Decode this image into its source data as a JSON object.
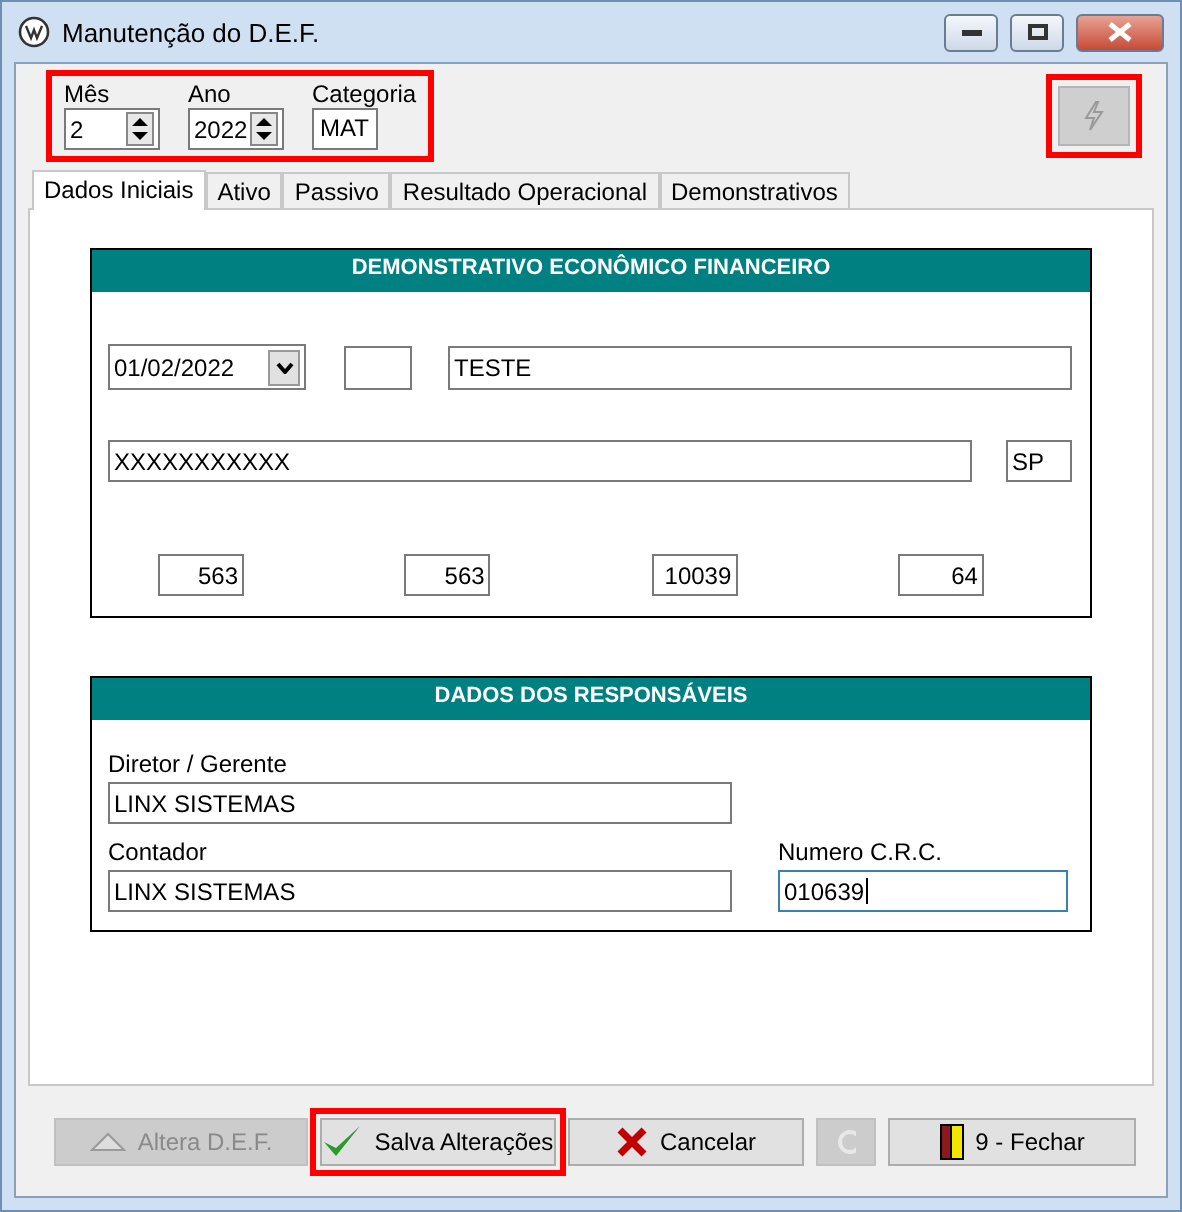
{
  "window": {
    "title": "Manutenção do D.E.F."
  },
  "period": {
    "highlighted": true,
    "fields": [
      {
        "label": "Mês",
        "value": "2",
        "kind": "spin"
      },
      {
        "label": "Ano",
        "value": "2022",
        "kind": "spin"
      },
      {
        "label": "Categoria",
        "value": "MAT",
        "kind": "text"
      }
    ]
  },
  "action_button": {
    "disabled": true,
    "highlighted": true
  },
  "tabs": [
    {
      "label": "Dados Iniciais",
      "selected": true
    },
    {
      "label": "Ativo",
      "selected": false
    },
    {
      "label": "Passivo",
      "selected": false
    },
    {
      "label": "Resultado Operacional",
      "selected": false
    },
    {
      "label": "Demonstrativos",
      "selected": false
    }
  ],
  "def_group": {
    "title": "DEMONSTRATIVO ECONÔMICO FINANCEIRO",
    "date": "01/02/2022",
    "name": "TESTE",
    "address": "XXXXXXXXXXX",
    "state": "SP",
    "numbers": [
      "563",
      "563",
      "10039",
      "64"
    ]
  },
  "responsaveis": {
    "title": "DADOS DOS RESPONSÁVEIS",
    "fields": [
      {
        "label": "Diretor / Gerente",
        "value": "LINX SISTEMAS",
        "focused": false
      },
      {
        "label": "Contador",
        "value": "LINX SISTEMAS",
        "focused": false
      },
      {
        "label": "Numero C.R.C.",
        "value": "010639",
        "focused": true
      }
    ]
  },
  "buttons": [
    {
      "kind": "edit",
      "label": "Altera D.E.F.",
      "disabled": true,
      "highlighted": false
    },
    {
      "kind": "save",
      "label": "Salva Alterações",
      "disabled": false,
      "highlighted": true
    },
    {
      "kind": "cancel",
      "label": "Cancelar",
      "disabled": false,
      "highlighted": false
    },
    {
      "kind": "hidden",
      "disabled": true,
      "highlighted": false
    },
    {
      "kind": "close",
      "label": "9 - Fechar",
      "disabled": false,
      "highlighted": false
    }
  ]
}
